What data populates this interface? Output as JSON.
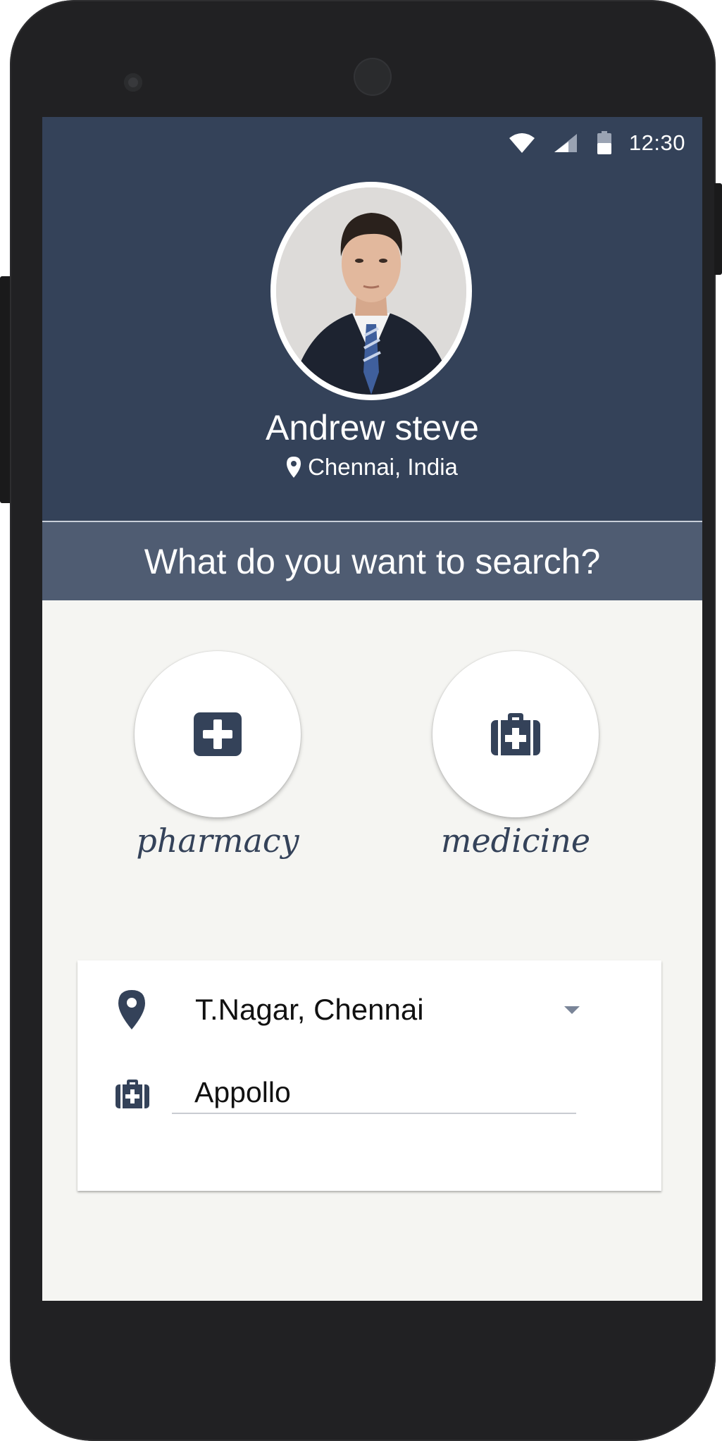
{
  "status_bar": {
    "time": "12:30",
    "icons": [
      "wifi-icon",
      "signal-icon",
      "battery-icon"
    ]
  },
  "profile": {
    "name": "Andrew steve",
    "location": "Chennai, India",
    "location_icon": "map-pin-icon"
  },
  "search_prompt": "What do you want to search?",
  "categories": [
    {
      "label": "pharmacy",
      "icon": "medical-cross-icon"
    },
    {
      "label": "medicine",
      "icon": "medical-kit-icon"
    }
  ],
  "search_form": {
    "location_value": "T.Nagar, Chennai",
    "location_icon": "map-pin-icon",
    "dropdown_icon": "dropdown-arrow-icon",
    "query_value": "Appollo",
    "query_icon": "medical-kit-icon"
  },
  "colors": {
    "header": "#344259",
    "banner": "#4f5c72",
    "accent_text": "#344259",
    "background": "#f5f5f2"
  }
}
